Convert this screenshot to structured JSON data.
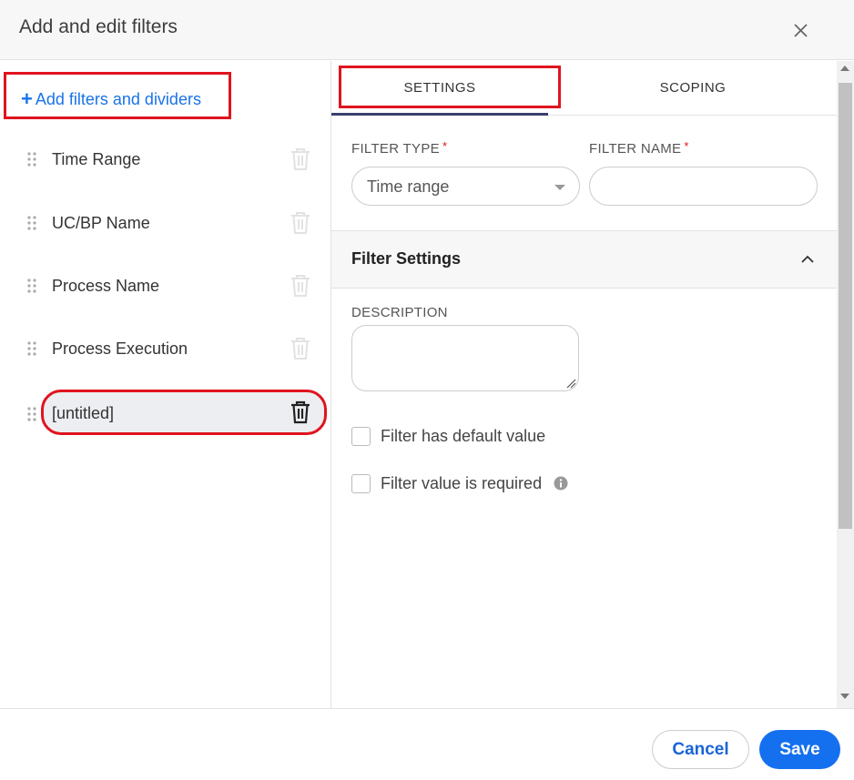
{
  "dialog": {
    "title": "Add and edit filters",
    "close_icon": "close-icon"
  },
  "left_panel": {
    "add_link_label": "Add filters and dividers",
    "filters": [
      {
        "label": "Time Range",
        "selected": false
      },
      {
        "label": "UC/BP Name",
        "selected": false
      },
      {
        "label": "Process Name",
        "selected": false
      },
      {
        "label": "Process Execution",
        "selected": false
      },
      {
        "label": "[untitled]",
        "selected": true
      }
    ]
  },
  "tabs": [
    {
      "label": "SETTINGS",
      "active": true
    },
    {
      "label": "SCOPING",
      "active": false
    }
  ],
  "form": {
    "filter_type_label": "FILTER TYPE",
    "filter_type_value": "Time range",
    "filter_name_label": "FILTER NAME",
    "filter_name_value": "",
    "required_marker": "*",
    "section_title": "Filter Settings",
    "description_label": "DESCRIPTION",
    "description_value": "",
    "checkboxes": [
      {
        "label": "Filter has default value",
        "checked": false
      },
      {
        "label": "Filter value is required",
        "checked": false,
        "info_icon": true
      }
    ]
  },
  "footer": {
    "cancel_label": "Cancel",
    "save_label": "Save"
  },
  "colors": {
    "accent_blue": "#1570ef",
    "link_blue": "#1a73e8",
    "highlight_red": "#e0141e",
    "tab_underline": "#3a3f6e",
    "selected_row_bg": "#edeef2"
  }
}
